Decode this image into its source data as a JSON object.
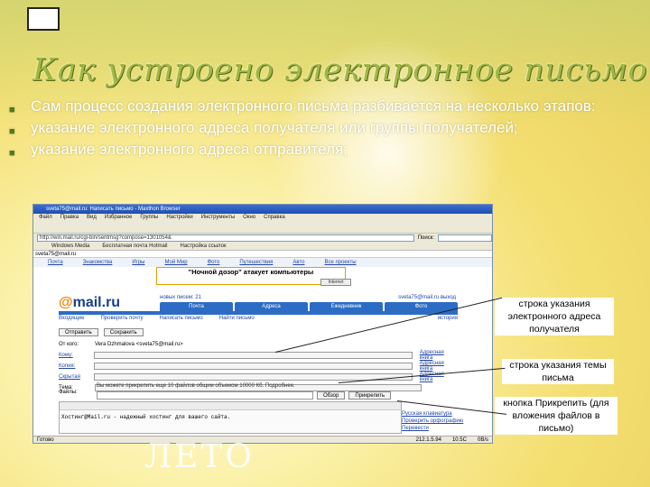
{
  "slide": {
    "title": "Как устроено электронное письмо",
    "bullets": [
      "Сам процесс создания электронного письма разбивается на несколько этапов:",
      "указание электронного адреса получателя или группы получателей;",
      "указание электронного адреса отправителя;"
    ],
    "footer_word": "ЛЕТО"
  },
  "browser": {
    "window_title": "sveta75@mail.ru: Написать письмо - Maxthon Browser",
    "menu": [
      "Файл",
      "Правка",
      "Вид",
      "Избранное",
      "Группы",
      "Настройки",
      "Инструменты",
      "Окно",
      "Справка"
    ],
    "address": "http://win.mail.ru/cgi-bin/sentmsg?compose=1301054&",
    "search_label": "Поиск:",
    "links": [
      "Windows Media",
      "Бесплатная почта Hotmail",
      "Настройка ссылок"
    ],
    "mailbar": "sveta75@mail.ru",
    "projects": [
      "Почта",
      "Знакомства",
      "Игры",
      "Мой Мир",
      "Фото",
      "Путешествия",
      "Авто",
      "Все проекты"
    ],
    "banner": "\"Ночной дозор\" атакует компьютеры",
    "internet_button": "Internet",
    "status_left": "Готово",
    "status_right": [
      "212.1.5.94",
      "10.5C",
      "0B/s"
    ]
  },
  "mail": {
    "logo_at": "@",
    "logo_text": "mail.ru",
    "new_mails": "новых писем: 21",
    "user": "sveta75@mail.ru",
    "exit": "выход",
    "tabs": [
      "Почта",
      "Адреса",
      "Ежедневник",
      "Фото"
    ],
    "actions": [
      "Входящие",
      "Проверить почту",
      "Написать письмо",
      "Найти письмо"
    ],
    "history": "история",
    "buttons": [
      "Отправить",
      "Сохранить"
    ],
    "from_label": "От кого:",
    "from_value": "Vera Dzhmalova <sveta75@mail.ru>",
    "to_label": "Кому:",
    "cc_label": "Копия:",
    "bcc_label": "Скрытая",
    "subject_label": "Тема:",
    "address_book": "Адресная книга",
    "files_label": "Файлы:",
    "files_note": "Вы можете прикрепить еще 10 файлов общим объемом 10000 Кб. Подробнее.",
    "browse_button": "Обзор",
    "attach_button": "Прикрепить",
    "editor_text": "Хостинг@Mail.ru - надежный хостинг для вашего сайта.",
    "side_links": [
      "Русская клавиатура",
      "Проверить орфографию",
      "Перевести"
    ]
  },
  "callouts": {
    "recipient": "строка указания электронного адреса получателя",
    "subject": "строка указания темы письма",
    "attach": "кнопка Прикрепить (для вложения файлов в письмо)"
  }
}
